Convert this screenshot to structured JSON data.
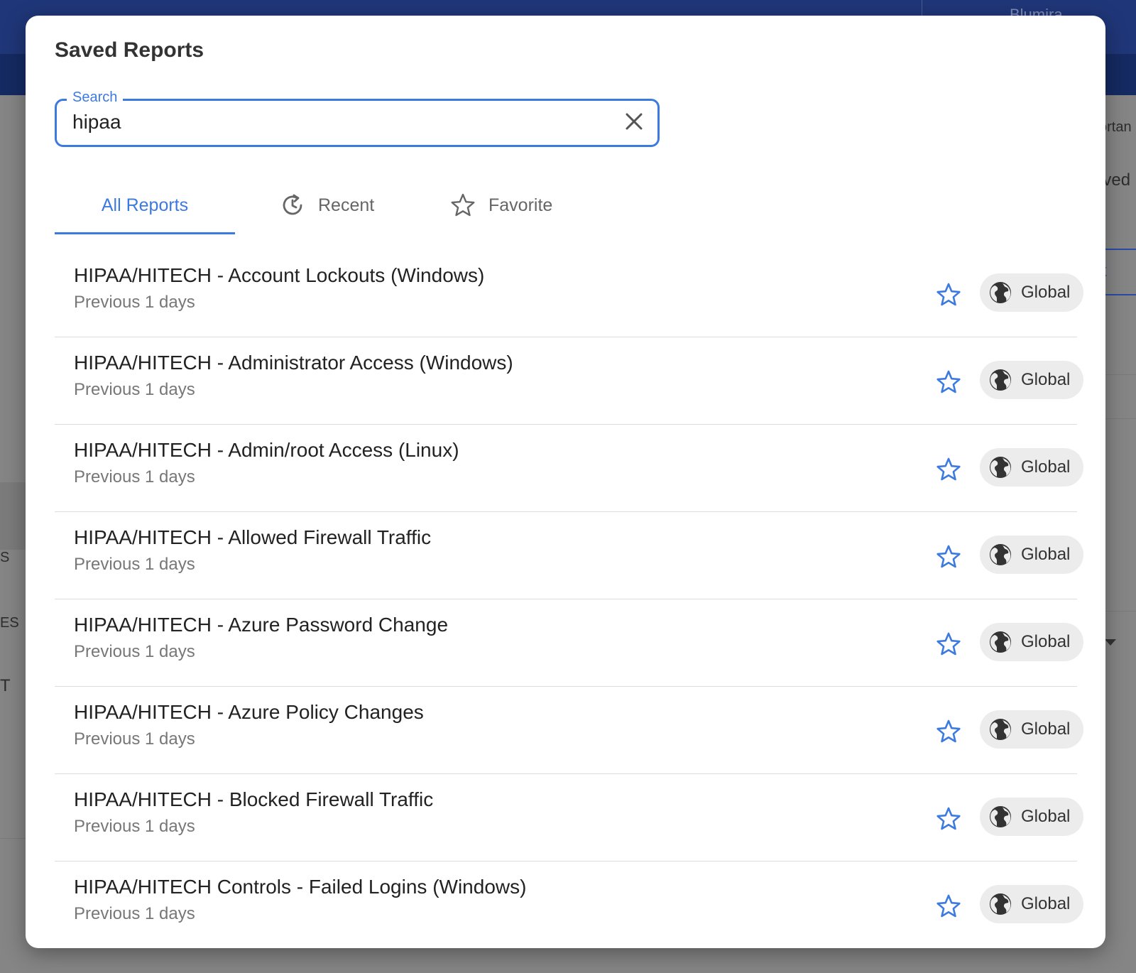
{
  "background": {
    "brand_text": "Blumira",
    "fragments": [
      "ortan",
      "aved",
      "rt",
      "S",
      "ES",
      "T"
    ]
  },
  "modal": {
    "title": "Saved Reports",
    "search": {
      "label": "Search",
      "value": "hipaa"
    },
    "tabs": [
      {
        "label": "All Reports",
        "icon": "none",
        "active": true
      },
      {
        "label": "Recent",
        "icon": "history-icon",
        "active": false
      },
      {
        "label": "Favorite",
        "icon": "star-outline-icon",
        "active": false
      }
    ],
    "reports": [
      {
        "name": "HIPAA/HITECH - Account Lockouts (Windows)",
        "range": "Previous 1 days",
        "scope": "Global"
      },
      {
        "name": "HIPAA/HITECH - Administrator Access (Windows)",
        "range": "Previous 1 days",
        "scope": "Global"
      },
      {
        "name": "HIPAA/HITECH - Admin/root Access (Linux)",
        "range": "Previous 1 days",
        "scope": "Global"
      },
      {
        "name": "HIPAA/HITECH - Allowed Firewall Traffic",
        "range": "Previous 1 days",
        "scope": "Global"
      },
      {
        "name": "HIPAA/HITECH - Azure Password Change",
        "range": "Previous 1 days",
        "scope": "Global"
      },
      {
        "name": "HIPAA/HITECH - Azure Policy Changes",
        "range": "Previous 1 days",
        "scope": "Global"
      },
      {
        "name": "HIPAA/HITECH - Blocked Firewall Traffic",
        "range": "Previous 1 days",
        "scope": "Global"
      },
      {
        "name": "HIPAA/HITECH Controls - Failed Logins (Windows)",
        "range": "Previous 1 days",
        "scope": "Global"
      }
    ]
  },
  "colors": {
    "accent": "#3d7ae0",
    "topbar": "#1f3678",
    "chip_bg": "#ececec"
  }
}
